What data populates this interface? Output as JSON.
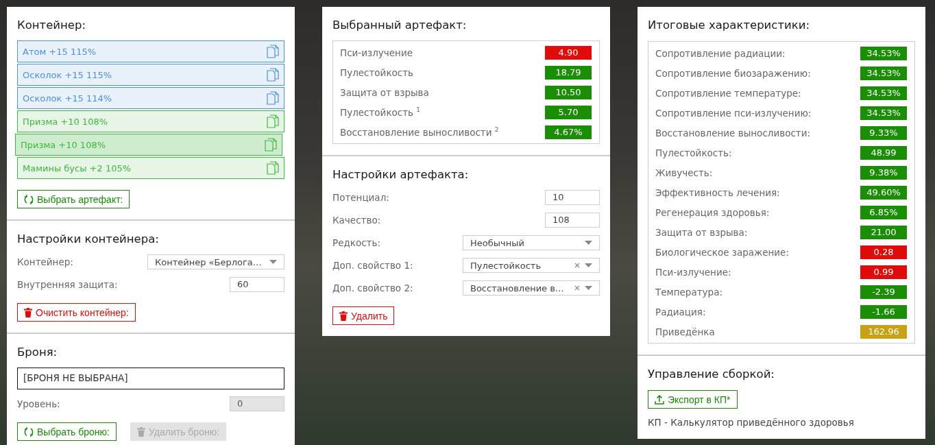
{
  "container_panel": {
    "title": "Контейнер:",
    "artifacts": [
      {
        "label": "Атом +15 115%",
        "color": "#4a90e2",
        "selected": false
      },
      {
        "label": "Осколок +15 115%",
        "color": "#4a90e2",
        "selected": false
      },
      {
        "label": "Осколок +15 114%",
        "color": "#4a90e2",
        "selected": false
      },
      {
        "label": "Призма +10 108%",
        "color": "#3cb83c",
        "selected": false
      },
      {
        "label": "Призма +10 108%",
        "color": "#3cb83c",
        "selected": true
      },
      {
        "label": "Мамины бусы +2 105%",
        "color": "#3cb83c",
        "selected": false
      }
    ],
    "button": {
      "label": "Выбрать артефакт:",
      "kind": "select",
      "disabled": false
    }
  },
  "container_settings": {
    "title": "Настройки контейнера:",
    "fields": [
      {
        "kind": "select",
        "label": "Контейнер:",
        "value": "Контейнер «Берлога…",
        "clearable": false
      },
      {
        "kind": "input",
        "label": "Внутренняя защита:",
        "value": "60",
        "disabled": false
      }
    ],
    "button": {
      "label": "Очистить контейнер:",
      "kind": "delete",
      "disabled": false
    }
  },
  "armor": {
    "title": "Броня:",
    "selected_armor": "[БРОНЯ НЕ ВЫБРАНА]",
    "fields": [
      {
        "kind": "input",
        "label": "Уровень:",
        "value": "0",
        "disabled": true
      }
    ],
    "buttons": [
      {
        "label": "Выбрать броню:",
        "kind": "select",
        "disabled": false
      },
      {
        "label": "Удалить броню:",
        "kind": "delete",
        "disabled": true
      }
    ]
  },
  "selected_artifact": {
    "title": "Выбранный артефакт:",
    "stats": [
      {
        "label": "Пси-излучение",
        "value": "4.90",
        "color": "#e00b0b"
      },
      {
        "label": "Пулестойкость",
        "value": "18.79",
        "color": "#1a8f06"
      },
      {
        "label": "Защита от взрыва",
        "value": "10.50",
        "color": "#1a8f06"
      },
      {
        "label": "Пулестойкость $^{1}$",
        "value": "5.70",
        "color": "#1a8f06"
      },
      {
        "label": "Восстановление выносливости $^{2}$",
        "value": "4.67%",
        "color": "#1a8f06"
      }
    ]
  },
  "artifact_settings": {
    "title": "Настройки артефакта:",
    "fields": [
      {
        "kind": "input",
        "label": "Потенциал:",
        "value": "10",
        "disabled": false
      },
      {
        "kind": "input",
        "label": "Качество:",
        "value": "108",
        "disabled": false
      },
      {
        "kind": "select",
        "label": "Редкость:",
        "value": "Необычный",
        "clearable": false
      },
      {
        "kind": "select",
        "label": "Доп. свойство 1:",
        "value": "Пулестойкость",
        "clearable": true
      },
      {
        "kind": "select",
        "label": "Доп. свойство 2:",
        "value": "Восстановление в…",
        "clearable": true
      }
    ],
    "button": {
      "label": "Удалить",
      "kind": "delete",
      "disabled": false
    }
  },
  "total_stats": {
    "title": "Итоговые характеристики:",
    "stats": [
      {
        "label": "Сопротивление радиации:",
        "value": "34.53%",
        "color": "#1a8f06"
      },
      {
        "label": "Сопротивление биозаражению:",
        "value": "34.53%",
        "color": "#1a8f06"
      },
      {
        "label": "Сопротивление температуре:",
        "value": "34.53%",
        "color": "#1a8f06"
      },
      {
        "label": "Сопротивление пси-излучению:",
        "value": "34.53%",
        "color": "#1a8f06"
      },
      {
        "label": "Восстановление выносливости:",
        "value": "9.33%",
        "color": "#1a8f06"
      },
      {
        "label": "Пулестойкость:",
        "value": "48.99",
        "color": "#1a8f06"
      },
      {
        "label": "Живучесть:",
        "value": "9.38%",
        "color": "#1a8f06"
      },
      {
        "label": "Эффективность лечения:",
        "value": "49.60%",
        "color": "#1a8f06"
      },
      {
        "label": "Регенерация здоровья:",
        "value": "6.85%",
        "color": "#1a8f06"
      },
      {
        "label": "Защита от взрыва:",
        "value": "21.00",
        "color": "#1a8f06"
      },
      {
        "label": "Биологическое заражение:",
        "value": "0.28",
        "color": "#e00b0b"
      },
      {
        "label": "Пси-излучение:",
        "value": "0.99",
        "color": "#e00b0b"
      },
      {
        "label": "Температура:",
        "value": "-2.39",
        "color": "#1a8f06"
      },
      {
        "label": "Радиация:",
        "value": "-1.66",
        "color": "#1a8f06"
      },
      {
        "label": "Приведёнка",
        "value": "162.96",
        "color": "#c9a114"
      }
    ]
  },
  "build_management": {
    "title": "Управление сборкой:",
    "button": {
      "label": "Экспорт в КП*",
      "kind": "export",
      "disabled": false
    },
    "note": "КП - Калькулятор приведённого здоровья"
  }
}
